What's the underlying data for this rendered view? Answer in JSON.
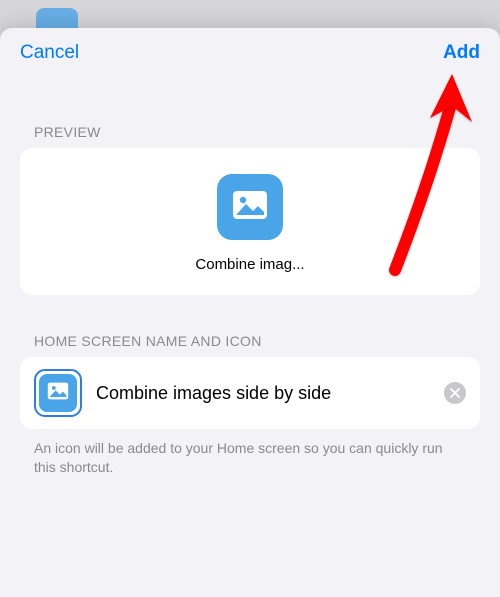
{
  "nav": {
    "cancel": "Cancel",
    "add": "Add"
  },
  "sections": {
    "preview_header": "PREVIEW",
    "name_header": "HOME SCREEN NAME AND ICON"
  },
  "preview": {
    "icon_name": "photo-icon",
    "label": "Combine imag..."
  },
  "name_row": {
    "icon_name": "photo-icon",
    "value": "Combine images side by side"
  },
  "footer": "An icon will be added to your Home screen so you can quickly run this shortcut.",
  "colors": {
    "accent": "#007aff",
    "icon_bg": "#4aa5e8"
  }
}
